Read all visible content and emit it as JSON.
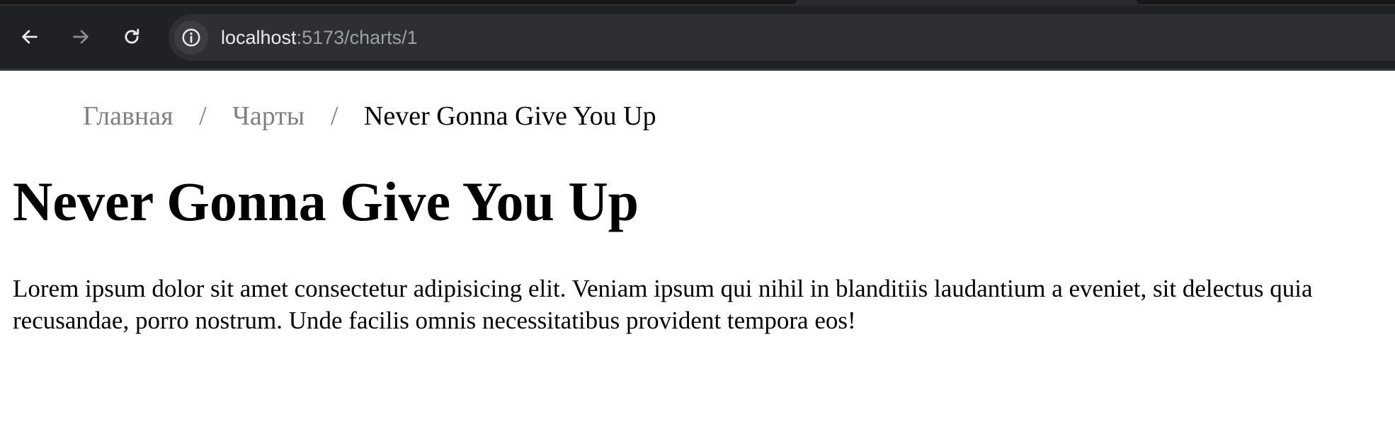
{
  "browser": {
    "url_host": "localhost",
    "url_rest": ":5173/charts/1",
    "icons": {
      "back": "arrow-left-icon",
      "forward": "arrow-right-icon",
      "reload": "reload-icon",
      "site_info": "info-icon"
    },
    "colors": {
      "chrome_bg": "#202124",
      "omnibox_bg": "#2e2f33",
      "url_host_text": "#e8eaed",
      "url_rest_text": "#9aa0a6"
    }
  },
  "breadcrumb": {
    "items": [
      "Главная",
      "Чарты"
    ],
    "separator": "/",
    "current": "Never Gonna Give You Up"
  },
  "page": {
    "title": "Never Gonna Give You Up",
    "description": "Lorem ipsum dolor sit amet consectetur adipisicing elit. Veniam ipsum qui nihil in blanditiis laudantium a eveniet, sit delectus quia recusandae, porro nostrum. Unde facilis omnis necessitatibus provident tempora eos!"
  },
  "colors": {
    "breadcrumb_link": "#808080",
    "text": "#000000",
    "background": "#ffffff"
  }
}
